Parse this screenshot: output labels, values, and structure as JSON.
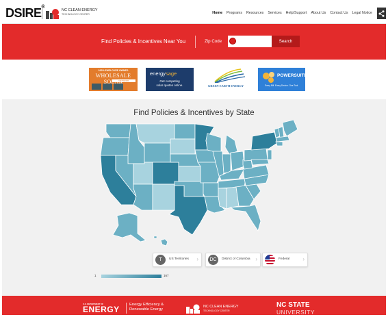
{
  "header": {
    "logo": "DSIRE",
    "logo_mark": "®",
    "ncce_line1": "NC CLEAN ENERGY",
    "ncce_line2": "TECHNOLOGY CENTER",
    "nav": [
      {
        "label": "Home",
        "active": true
      },
      {
        "label": "Programs"
      },
      {
        "label": "Resources"
      },
      {
        "label": "Services"
      },
      {
        "label": "Help/Support"
      },
      {
        "label": "About Us"
      },
      {
        "label": "Contact Us"
      },
      {
        "label": "Legal Notice"
      }
    ],
    "share_icon": "share-icon"
  },
  "search": {
    "label": "Find Policies & Incentives Near You",
    "zip_label": "Zip Code",
    "zip_value": "",
    "button": "Search"
  },
  "sponsors": {
    "wholesale_top": "100% EMPLOYEE OWNED",
    "wholesale_name": "WHOLESALE SOLAR",
    "wholesale_tag": "NETWORK",
    "wholesale_boxes": [
      "",
      "",
      ""
    ],
    "energysage_name_a": "energy",
    "energysage_name_b": "sage",
    "energysage_tag1": "Get competing",
    "energysage_tag2": "solar quotes online.",
    "greenearth": "GREEN EARTH ENERGY",
    "powersuite": "POWERSUITE",
    "powersuite_tag": "Every Bill. Every Device. One Tool."
  },
  "map": {
    "title": "Find Policies & Incentives by State",
    "colors": {
      "light": "#a8d3df",
      "mid": "#6cb0c4",
      "dark": "#2d7f9b"
    },
    "pills": [
      {
        "icon_text": "T",
        "label": "US Territories"
      },
      {
        "icon_text": "DC",
        "label": "District of Columbia"
      },
      {
        "icon_text": "",
        "label": "Federal"
      }
    ],
    "legend_min": "1",
    "legend_max": "167"
  },
  "footer": {
    "doe_small": "U.S. DEPARTMENT OF",
    "doe": "ENERGY",
    "eere_line1": "Energy Efficiency &",
    "eere_line2": "Renewable Energy",
    "ncce_line1": "NC CLEAN ENERGY",
    "ncce_line2": "TECHNOLOGY CENTER",
    "ncsu_line1": "NC STATE",
    "ncsu_line2": "UNIVERSITY"
  }
}
